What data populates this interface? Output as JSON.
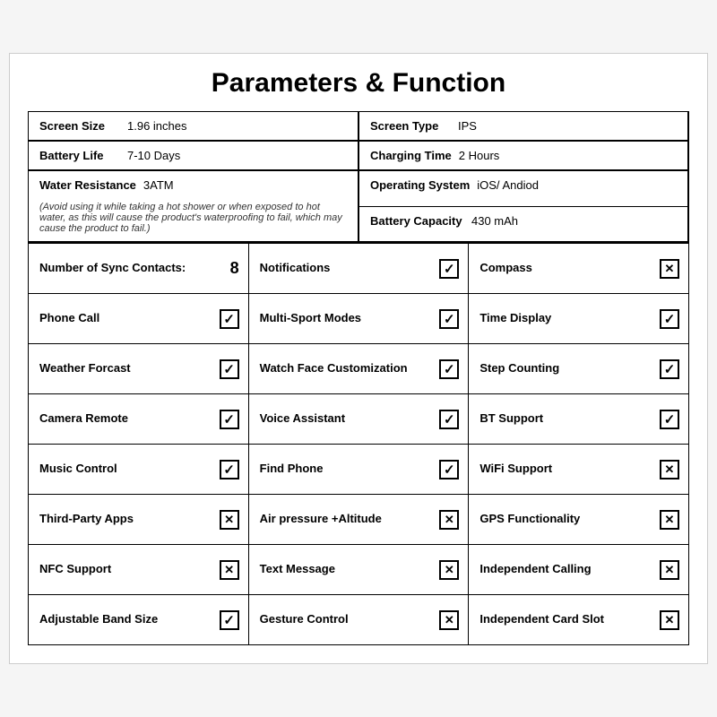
{
  "title": "Parameters & Function",
  "specs": {
    "screen_size_label": "Screen Size",
    "screen_size_value": "1.96 inches",
    "screen_type_label": "Screen Type",
    "screen_type_value": "IPS",
    "battery_life_label": "Battery Life",
    "battery_life_value": "7-10 Days",
    "charging_time_label": "Charging Time",
    "charging_time_value": "2 Hours",
    "water_resistance_label": "Water Resistance",
    "water_resistance_value": "3ATM",
    "water_note": "(Avoid using it while taking a hot shower or when exposed to hot water, as this will cause the product's waterproofing to fail, which may cause the product to fail.)",
    "os_label": "Operating System",
    "os_value": "iOS/ Andiod",
    "battery_capacity_label": "Battery Capacity",
    "battery_capacity_value": "430 mAh"
  },
  "features": [
    {
      "label": "Number of Sync Contacts:",
      "value": "8",
      "type": "number",
      "col": 1
    },
    {
      "label": "Notifications",
      "checked": true,
      "type": "check",
      "col": 2
    },
    {
      "label": "Compass",
      "checked": false,
      "type": "cross",
      "col": 3
    },
    {
      "label": "Phone Call",
      "checked": true,
      "type": "check",
      "col": 1
    },
    {
      "label": "Multi-Sport Modes",
      "checked": true,
      "type": "check",
      "col": 2
    },
    {
      "label": "Time Display",
      "checked": true,
      "type": "check",
      "col": 3
    },
    {
      "label": "Weather Forcast",
      "checked": true,
      "type": "check",
      "col": 1
    },
    {
      "label": "Watch Face Customization",
      "checked": true,
      "type": "check",
      "col": 2
    },
    {
      "label": "Step Counting",
      "checked": true,
      "type": "check",
      "col": 3
    },
    {
      "label": "Camera Remote",
      "checked": true,
      "type": "check",
      "col": 1
    },
    {
      "label": "Voice Assistant",
      "checked": true,
      "type": "check",
      "col": 2
    },
    {
      "label": "BT Support",
      "checked": true,
      "type": "check",
      "col": 3
    },
    {
      "label": "Music Control",
      "checked": true,
      "type": "check",
      "col": 1
    },
    {
      "label": "Find Phone",
      "checked": true,
      "type": "check",
      "col": 2
    },
    {
      "label": "WiFi Support",
      "checked": false,
      "type": "cross",
      "col": 3
    },
    {
      "label": "Third-Party Apps",
      "checked": false,
      "type": "cross",
      "col": 1
    },
    {
      "label": "Air pressure +Altitude",
      "checked": false,
      "type": "cross",
      "col": 2
    },
    {
      "label": "GPS Functionality",
      "checked": false,
      "type": "cross",
      "col": 3
    },
    {
      "label": "NFC Support",
      "checked": false,
      "type": "cross",
      "col": 1
    },
    {
      "label": "Text Message",
      "checked": false,
      "type": "cross",
      "col": 2
    },
    {
      "label": "Independent Calling",
      "checked": false,
      "type": "cross",
      "col": 3
    },
    {
      "label": "Adjustable Band Size",
      "checked": true,
      "type": "check",
      "col": 1
    },
    {
      "label": "Gesture Control",
      "checked": false,
      "type": "cross",
      "col": 2
    },
    {
      "label": "Independent Card Slot",
      "checked": false,
      "type": "cross",
      "col": 3
    }
  ]
}
